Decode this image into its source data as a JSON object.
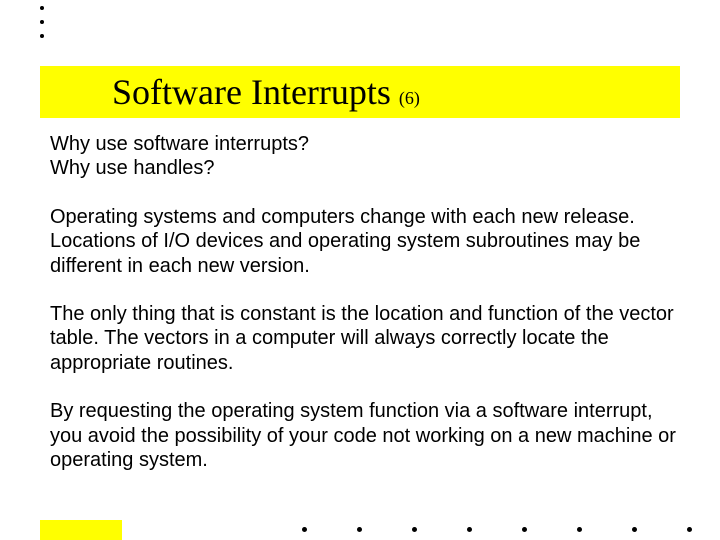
{
  "title": {
    "main": "Software Interrupts",
    "suffix": "(6)"
  },
  "body": {
    "q1": "Why use software interrupts?",
    "q2": "Why use handles?",
    "p1": "Operating systems and computers change with each new release. Locations of I/O devices and operating system subroutines may be different in each new version.",
    "p2": "The only thing that is constant is the location and function of the vector table. The vectors in a computer will always correctly locate the appropriate routines.",
    "p3": "By requesting the operating system function via a software interrupt, you avoid the possibility of your code not working on a new machine or operating system."
  }
}
